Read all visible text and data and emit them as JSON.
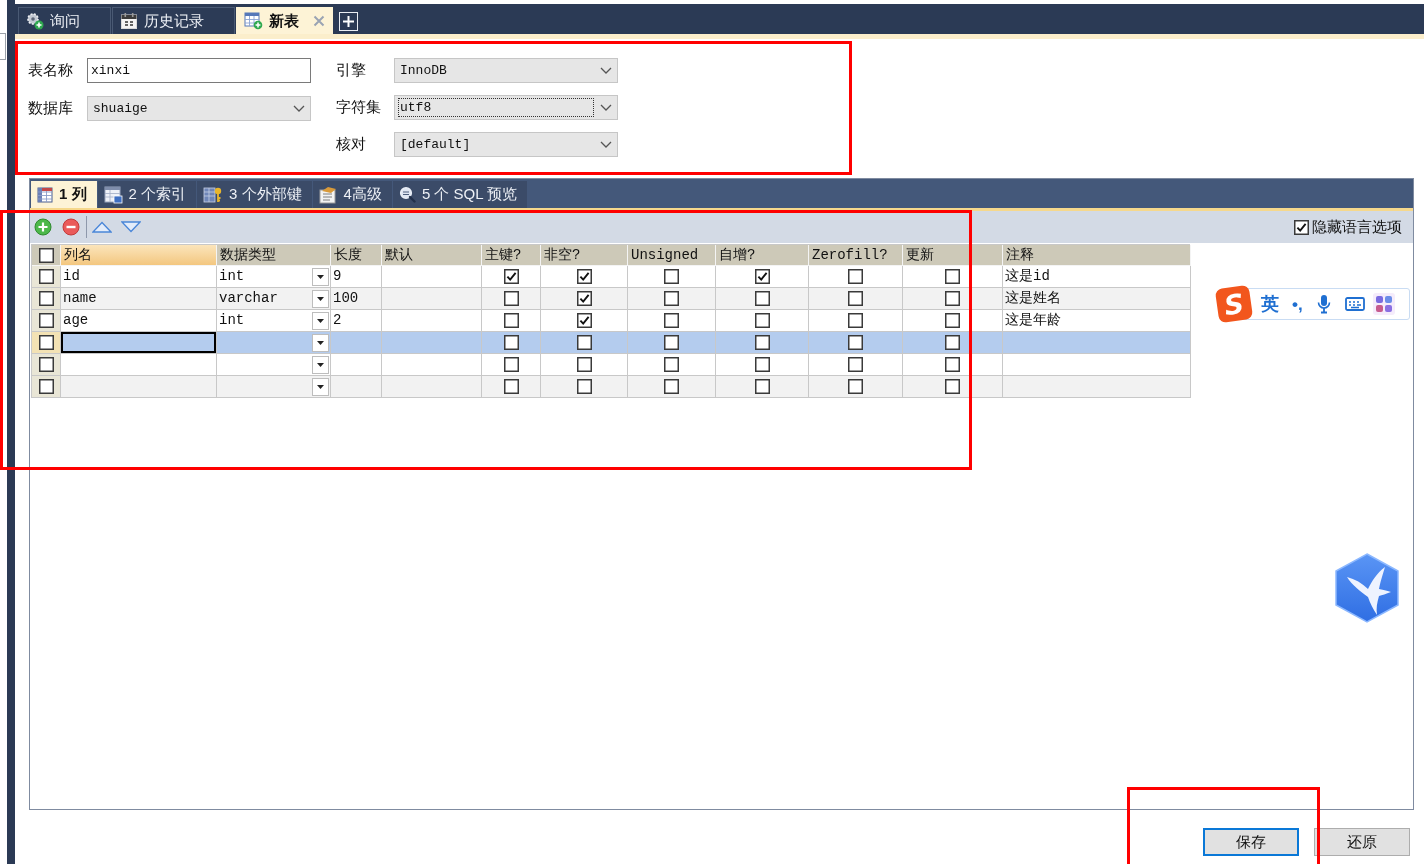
{
  "tabs": [
    {
      "label": "询问",
      "selected": false
    },
    {
      "label": "历史记录",
      "selected": false
    },
    {
      "label": "新表",
      "selected": true
    }
  ],
  "form": {
    "left": [
      {
        "label": "表名称",
        "kind": "text",
        "value": "xinxi"
      },
      {
        "label": "数据库",
        "kind": "select",
        "value": "shuaige"
      }
    ],
    "right": [
      {
        "label": "引擎",
        "kind": "select",
        "value": "InnoDB",
        "focused": false
      },
      {
        "label": "字符集",
        "kind": "select",
        "value": "utf8",
        "focused": true
      },
      {
        "label": "核对",
        "kind": "select",
        "value": "[default]",
        "focused": false
      }
    ]
  },
  "subtabs": [
    {
      "label": "1 列",
      "selected": true
    },
    {
      "label": "2 个索引",
      "selected": false
    },
    {
      "label": "3 个外部键",
      "selected": false
    },
    {
      "label": "4高级",
      "selected": false
    },
    {
      "label": "5 个 SQL 预览",
      "selected": false
    }
  ],
  "hide_language_options": {
    "label": "隐藏语言选项",
    "checked": true
  },
  "grid": {
    "select_all": false,
    "columns": [
      {
        "label": "列名",
        "kind": "text",
        "selected": true
      },
      {
        "label": "数据类型",
        "kind": "dropdown",
        "selected": false
      },
      {
        "label": "长度",
        "kind": "text",
        "selected": false
      },
      {
        "label": "默认",
        "kind": "text",
        "selected": false
      },
      {
        "label": "主键?",
        "kind": "check",
        "selected": false
      },
      {
        "label": "非空?",
        "kind": "check",
        "selected": false
      },
      {
        "label": "Unsigned",
        "kind": "check",
        "selected": false
      },
      {
        "label": "自增?",
        "kind": "check",
        "selected": false
      },
      {
        "label": "Zerofill?",
        "kind": "check",
        "selected": false
      },
      {
        "label": "更新",
        "kind": "check",
        "selected": false
      },
      {
        "label": "注释",
        "kind": "text",
        "selected": false
      }
    ],
    "rows": [
      {
        "checked": false,
        "selected": false,
        "name": "id",
        "type": "int",
        "length": "9",
        "primary_key": true,
        "not_null": true,
        "unsigned": false,
        "auto_increment": true,
        "zerofill": false,
        "on_update": false,
        "comment": "这是id"
      },
      {
        "checked": false,
        "selected": false,
        "name": "name",
        "type": "varchar",
        "length": "100",
        "primary_key": false,
        "not_null": true,
        "unsigned": false,
        "auto_increment": false,
        "zerofill": false,
        "on_update": false,
        "comment": "这是姓名"
      },
      {
        "checked": false,
        "selected": false,
        "name": "age",
        "type": "int",
        "length": "2",
        "primary_key": false,
        "not_null": true,
        "unsigned": false,
        "auto_increment": false,
        "zerofill": false,
        "on_update": false,
        "comment": "这是年龄"
      },
      {
        "checked": false,
        "selected": true,
        "primary_key": false,
        "not_null": false,
        "unsigned": false,
        "auto_increment": false,
        "zerofill": false,
        "on_update": false
      },
      {
        "checked": false,
        "selected": false,
        "primary_key": false,
        "not_null": false,
        "unsigned": false,
        "auto_increment": false,
        "zerofill": false,
        "on_update": false
      },
      {
        "checked": false,
        "selected": false,
        "primary_key": false,
        "not_null": false,
        "unsigned": false,
        "auto_increment": false,
        "zerofill": false,
        "on_update": false
      }
    ]
  },
  "ime_bar": {
    "logo": "S",
    "mode": "英",
    "punctuation": "•,"
  },
  "buttons": [
    {
      "label": "保存",
      "focused": true
    },
    {
      "label": "还原",
      "focused": false
    }
  ]
}
